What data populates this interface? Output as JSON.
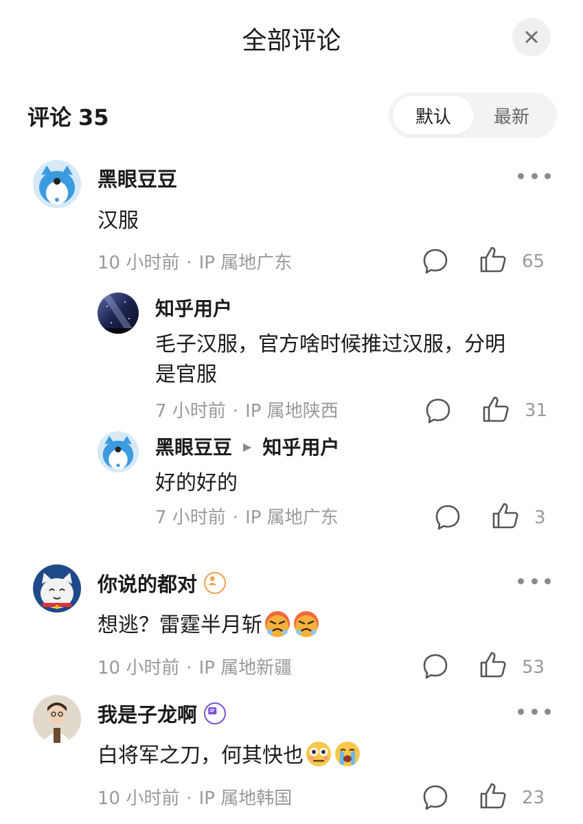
{
  "header": {
    "title": "全部评论"
  },
  "comments_header": {
    "label": "评论",
    "count": "35"
  },
  "sort": {
    "default_label": "默认",
    "latest_label": "最新",
    "selected": "默认"
  },
  "comments": [
    {
      "user": "黑眼豆豆",
      "text": "汉服",
      "time": "10 小时前",
      "ip": "IP 属地广东",
      "likes": "65",
      "replies": [
        {
          "user": "知乎用户",
          "text_line1": "毛子汉服，官方啥时候推过汉服，分明",
          "text_line2": "是官服",
          "time": "7 小时前",
          "ip": "IP 属地陕西",
          "likes": "31"
        },
        {
          "user": "黑眼豆豆",
          "reply_to": "知乎用户",
          "text": "好的好的",
          "time": "7 小时前",
          "ip": "IP 属地广东",
          "likes": "3"
        }
      ]
    },
    {
      "user": "你说的都对",
      "text": "想逃？雷霆半月斩",
      "emojis": [
        "angry-face-emoji",
        "angry-face-emoji"
      ],
      "time": "10 小时前",
      "ip": "IP 属地新疆",
      "likes": "53"
    },
    {
      "user": "我是子龙啊",
      "text": "白将军之刀，何其快也",
      "emojis": [
        "flushed-face-emoji",
        "crying-face-emoji"
      ],
      "time": "10 小时前",
      "ip": "IP 属地韩国",
      "likes": "23"
    }
  ],
  "meta_separator": "·",
  "colors": {
    "accent": "#1a1a1a",
    "muted": "#999999",
    "badge_orange": "#f0a050",
    "badge_purple": "#7a50d8"
  }
}
